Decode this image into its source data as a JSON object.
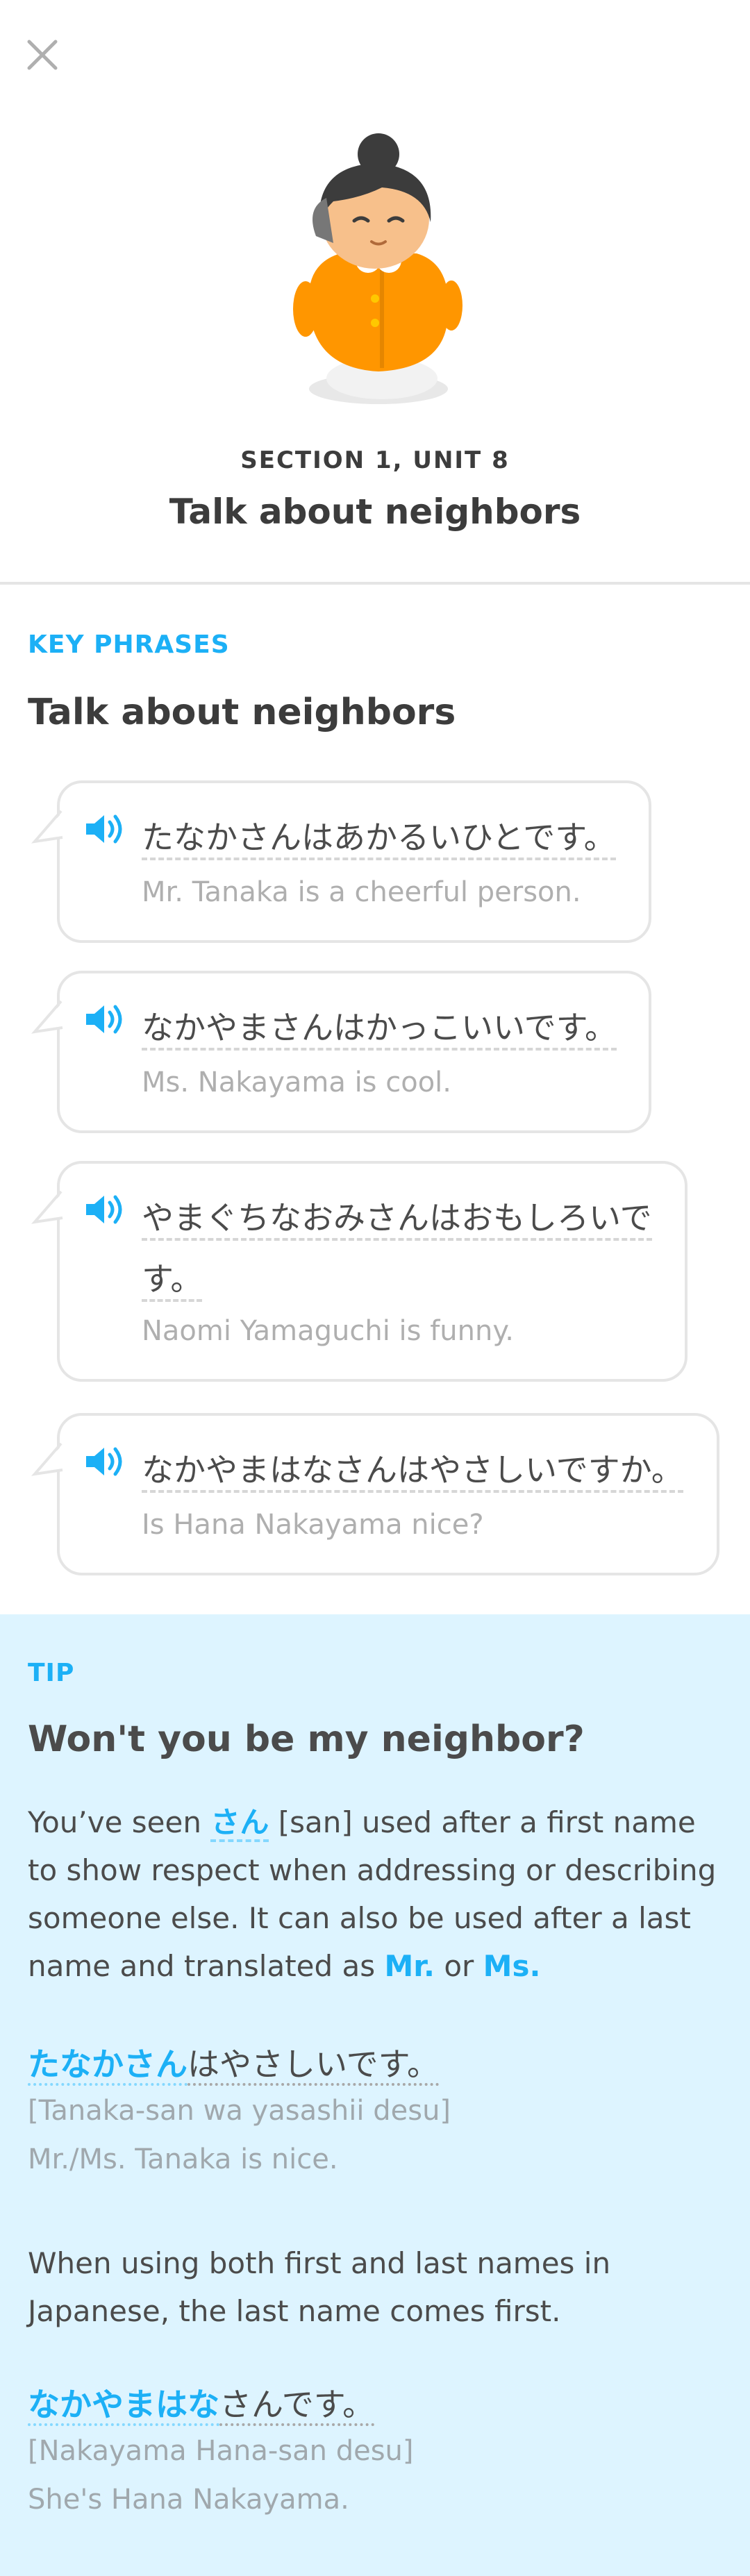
{
  "header": {
    "close_icon": "close-icon",
    "section_label": "SECTION 1, UNIT 8",
    "unit_title": "Talk about neighbors"
  },
  "key_phrases": {
    "label": "KEY PHRASES",
    "title": "Talk about neighbors",
    "phrases": [
      {
        "jp": "たなかさんはあかるいひとです。",
        "en": "Mr. Tanaka is a cheerful person."
      },
      {
        "jp": "なかやまさんはかっこいいです。",
        "en": "Ms. Nakayama is cool."
      },
      {
        "jp_line1": "やまぐちなおみさんはおもしろいで",
        "jp_line2": "す。",
        "en": "Naomi Yamaguchi is funny."
      },
      {
        "jp": "なかやまはなさんはやさしいですか。",
        "en": "Is Hana Nakayama nice?"
      }
    ]
  },
  "tip": {
    "label": "TIP",
    "title": "Won't you be my neighbor?",
    "para1": {
      "a": "You’ve seen ",
      "san": "さん",
      "b": " [san] used after a first name to show respect when addressing or describing someone else. It can also be used after a last name and translated as ",
      "mr": "Mr.",
      "or": " or ",
      "ms": "Ms."
    },
    "example1": {
      "jp_highlight": "たなかさん",
      "jp_rest": "はやさしいです。",
      "romaji": "[Tanaka-san wa yasashii desu]",
      "en": "Mr./Ms. Tanaka is nice."
    },
    "para2": "When using both first and last names in Japanese, the last name comes first.",
    "example2": {
      "jp_highlight": "なかやまはな",
      "jp_rest": "さんです。",
      "romaji": "[Nakayama Hana-san desu]",
      "en": "She's Hana Nakayama."
    }
  },
  "colors": {
    "accent": "#1cb0f6",
    "tip_background": "#ddf4ff",
    "border": "#e5e5e5",
    "mascot_outfit": "#ff9600"
  }
}
